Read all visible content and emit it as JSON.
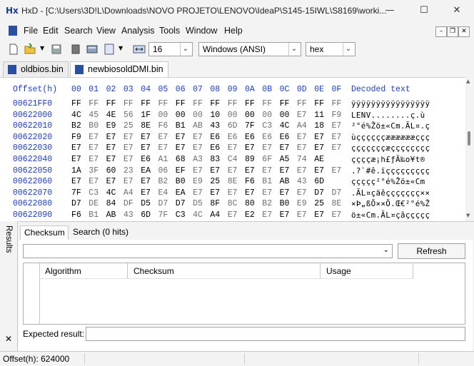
{
  "window": {
    "app_icon_text": "Hx",
    "title": "HxD - [C:\\Users\\3D!L\\Downloads\\NOVO PROJETO\\LENOVO\\IdeaP\\S145-15IWL\\S8169\\worki...",
    "minimize": "—",
    "maximize": "☐",
    "close": "✕"
  },
  "menu": {
    "items": [
      "File",
      "Edit",
      "Search",
      "View",
      "Analysis",
      "Tools",
      "Window",
      "Help"
    ],
    "mdi_minimize": "–",
    "mdi_restore": "❐",
    "mdi_close": "✕"
  },
  "toolbar": {
    "bytes_per_row": "16",
    "charset": "Windows (ANSI)",
    "display_mode": "hex"
  },
  "tabs": [
    {
      "label": "oldbios.bin",
      "active": false
    },
    {
      "label": "newbiosoldDMI.bin",
      "active": true
    }
  ],
  "hex": {
    "offset_header": "Offset(h)",
    "columns": [
      "00",
      "01",
      "02",
      "03",
      "04",
      "05",
      "06",
      "07",
      "08",
      "09",
      "0A",
      "0B",
      "0C",
      "0D",
      "0E",
      "0F"
    ],
    "decoded_header": "Decoded text",
    "rows": [
      {
        "offset": "00621FF0",
        "bytes": [
          "FF",
          "FF",
          "FF",
          "FF",
          "FF",
          "FF",
          "FF",
          "FF",
          "FF",
          "FF",
          "FF",
          "FF",
          "FF",
          "FF",
          "FF",
          "FF"
        ],
        "decoded": "ÿÿÿÿÿÿÿÿÿÿÿÿÿÿÿÿ"
      },
      {
        "offset": "00622000",
        "bytes": [
          "4C",
          "45",
          "4E",
          "56",
          "1F",
          "00",
          "00",
          "00",
          "10",
          "00",
          "00",
          "00",
          "00",
          "E7",
          "11",
          "F9"
        ],
        "decoded": "LENV........ç.ù"
      },
      {
        "offset": "00622010",
        "bytes": [
          "B2",
          "B0",
          "E9",
          "25",
          "8E",
          "F6",
          "B1",
          "AB",
          "43",
          "6D",
          "7F",
          "C3",
          "4C",
          "A4",
          "18",
          "E7"
        ],
        "decoded": "²°é%Žö±«Cm.ÃL¤.ç"
      },
      {
        "offset": "00622020",
        "bytes": [
          "F9",
          "E7",
          "E7",
          "E7",
          "E7",
          "E7",
          "E7",
          "E7",
          "E6",
          "E6",
          "E6",
          "E6",
          "E6",
          "E7",
          "E7",
          "E7"
        ],
        "decoded": "ùççççççææææææççç"
      },
      {
        "offset": "00622030",
        "bytes": [
          "E7",
          "E7",
          "E7",
          "E7",
          "E7",
          "E7",
          "E7",
          "E7",
          "E6",
          "E7",
          "E7",
          "E7",
          "E7",
          "E7",
          "E7",
          "E7"
        ],
        "decoded": "çççççççæçççççççç"
      },
      {
        "offset": "00622040",
        "bytes": [
          "E7",
          "E7",
          "E7",
          "E7",
          "E6",
          "A1",
          "68",
          "A3",
          "83",
          "C4",
          "89",
          "6F",
          "A5",
          "74",
          "AE"
        ],
        "decoded": "ççççæ¡h£ƒÄ‰o¥t®"
      },
      {
        "offset": "00622050",
        "bytes": [
          "1A",
          "3F",
          "60",
          "23",
          "EA",
          "06",
          "EF",
          "E7",
          "E7",
          "E7",
          "E7",
          "E7",
          "E7",
          "E7",
          "E7",
          "E7"
        ],
        "decoded": ".?`#ê.ïççççççççç"
      },
      {
        "offset": "00622060",
        "bytes": [
          "E7",
          "E7",
          "E7",
          "E7",
          "E7",
          "B2",
          "B0",
          "E9",
          "25",
          "8E",
          "F6",
          "B1",
          "AB",
          "43",
          "6D"
        ],
        "decoded": "ççççç²°é%Žö±«Cm"
      },
      {
        "offset": "00622070",
        "bytes": [
          "7F",
          "C3",
          "4C",
          "A4",
          "E7",
          "E4",
          "EA",
          "E7",
          "E7",
          "E7",
          "E7",
          "E7",
          "E7",
          "E7",
          "D7",
          "D7"
        ],
        "decoded": ".ÃL¤çäêççççççç××"
      },
      {
        "offset": "00622080",
        "bytes": [
          "D7",
          "DE",
          "84",
          "DF",
          "D5",
          "D7",
          "D7",
          "D5",
          "8F",
          "8C",
          "80",
          "B2",
          "B0",
          "E9",
          "25",
          "8E"
        ],
        "decoded": "×Þ„ßÕ××Õ.Œ€²°é%Ž"
      },
      {
        "offset": "00622090",
        "bytes": [
          "F6",
          "B1",
          "AB",
          "43",
          "6D",
          "7F",
          "C3",
          "4C",
          "A4",
          "E7",
          "E2",
          "E7",
          "E7",
          "E7",
          "E7",
          "E7"
        ],
        "decoded": "ö±«Cm.ÃL¤çâççççç"
      }
    ]
  },
  "results": {
    "side_label": "Results",
    "close": "✕",
    "tabs": [
      {
        "label": "Checksum",
        "active": true
      },
      {
        "label": "Search (0 hits)",
        "active": false
      }
    ],
    "algorithm_value": "",
    "refresh_label": "Refresh",
    "columns": [
      "Algorithm",
      "Checksum",
      "Usage"
    ],
    "expected_label": "Expected result:",
    "expected_value": ""
  },
  "status": {
    "offset_text": "Offset(h): 624000"
  }
}
